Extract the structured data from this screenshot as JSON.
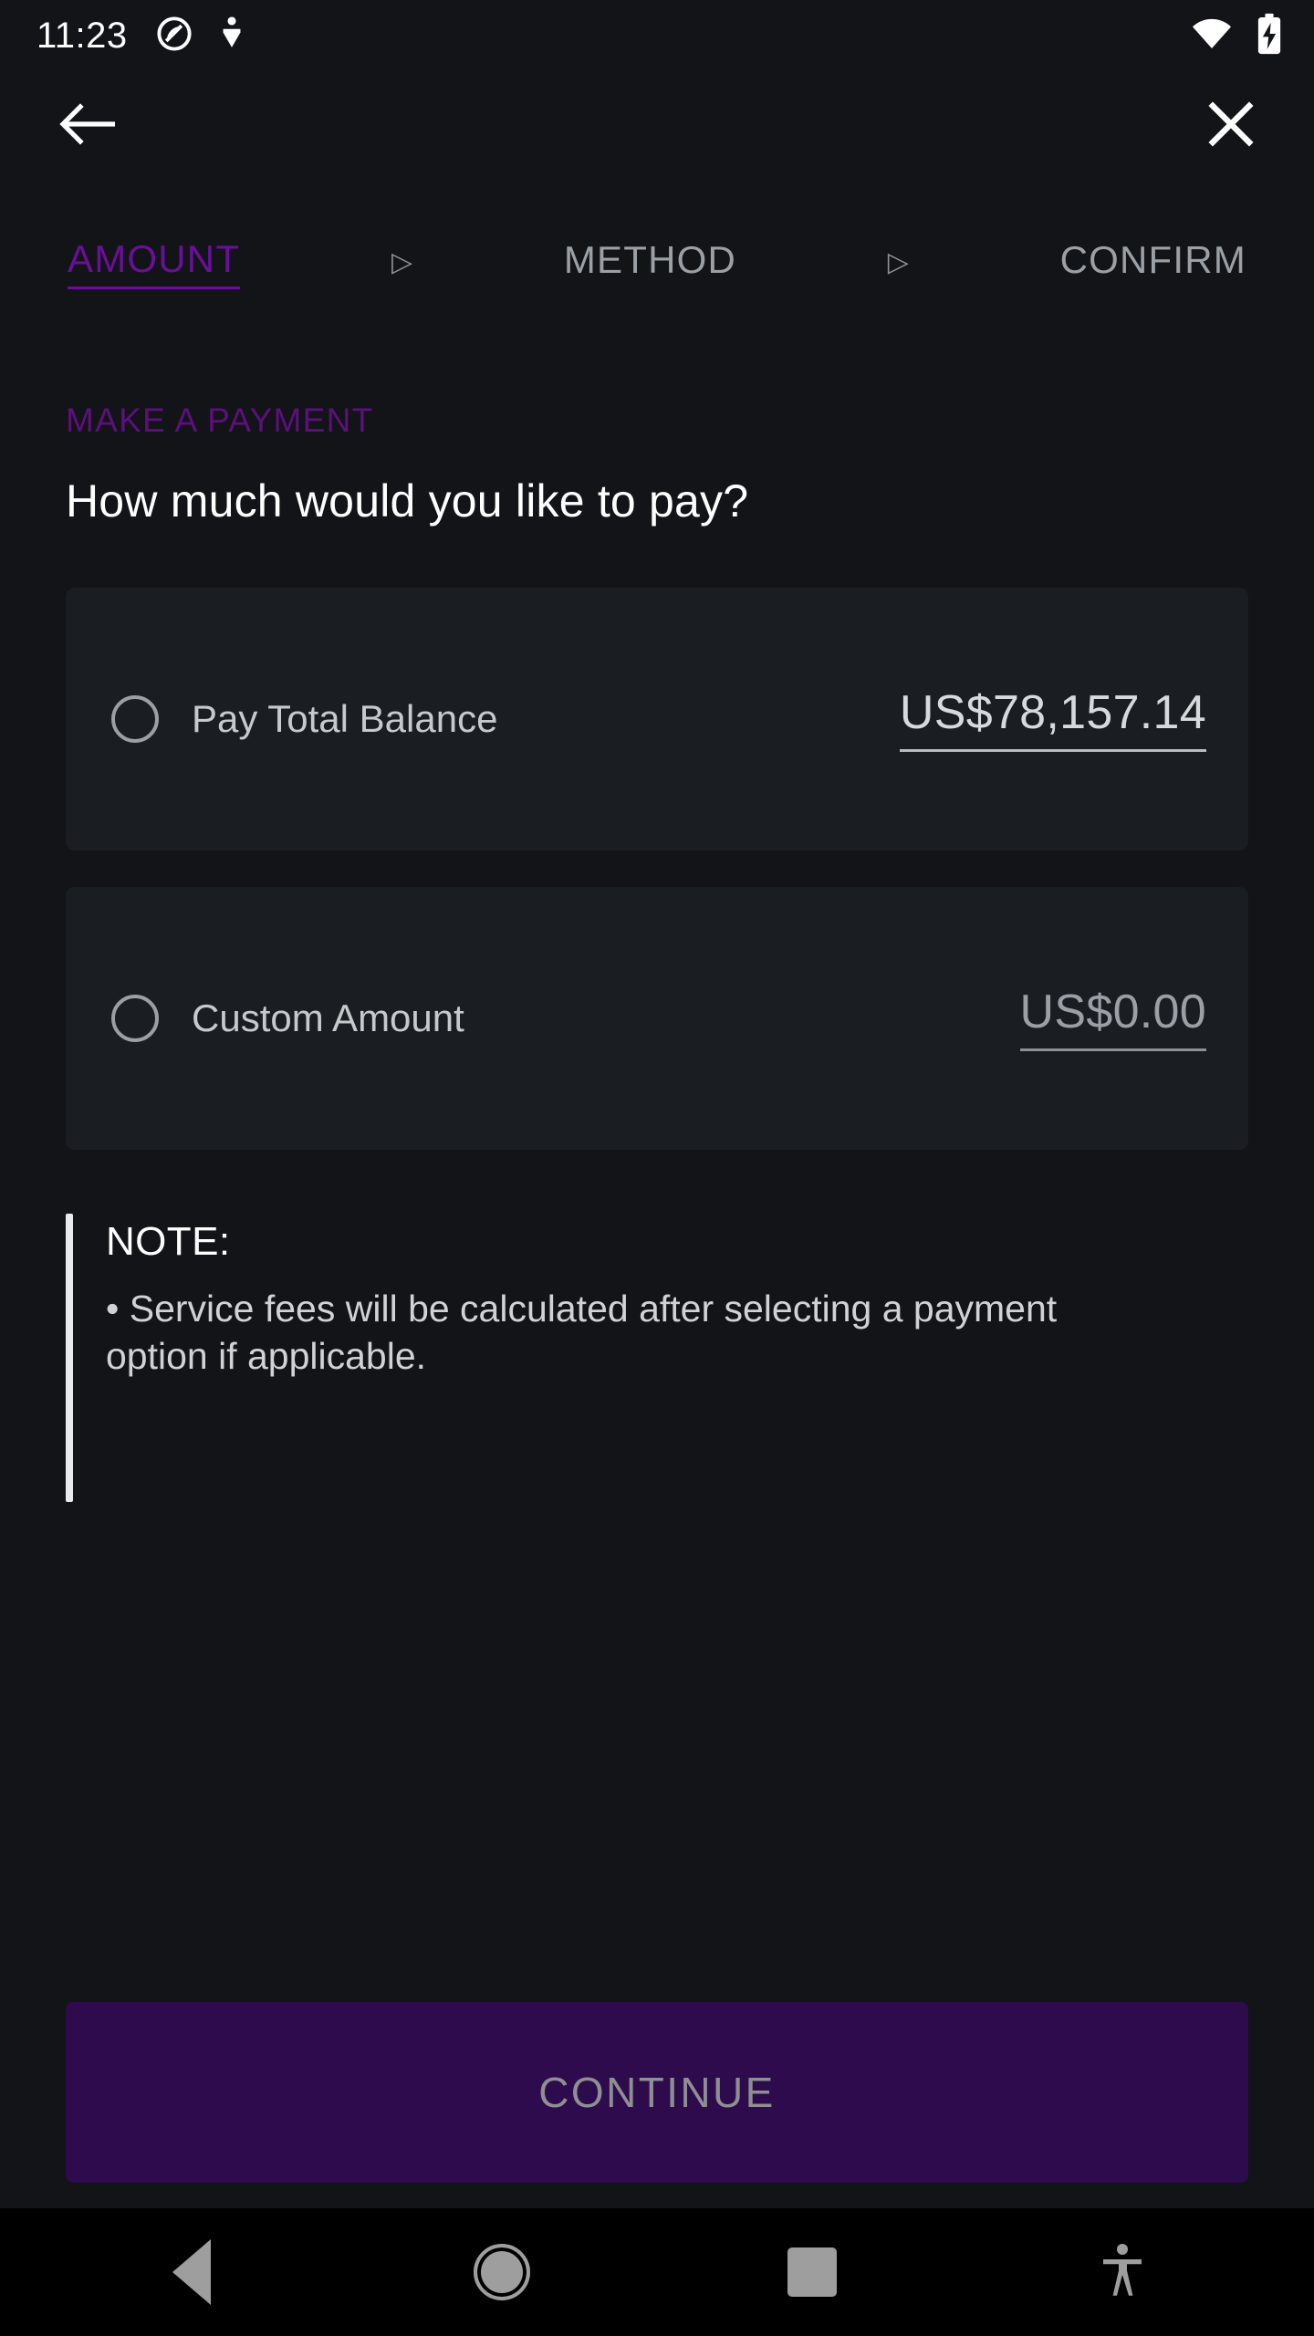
{
  "status_bar": {
    "time": "11:23",
    "left_icons": [
      "do-not-disturb-icon",
      "location-pin-icon"
    ],
    "right_icons": [
      "wifi-icon",
      "battery-charging-icon"
    ]
  },
  "app_bar": {
    "back_icon": "back-arrow-icon",
    "close_icon": "close-icon"
  },
  "stepper": {
    "separator": "▷",
    "steps": [
      {
        "label": "AMOUNT",
        "state": "active"
      },
      {
        "label": "METHOD",
        "state": "inactive"
      },
      {
        "label": "CONFIRM",
        "state": "inactive"
      }
    ]
  },
  "main": {
    "eyebrow": "MAKE A PAYMENT",
    "headline": "How much would you like to pay?",
    "options": [
      {
        "label": "Pay Total Balance",
        "value": "US$78,157.14",
        "selected": false
      },
      {
        "label": "Custom Amount",
        "value": "US$0.00",
        "selected": false
      }
    ],
    "note": {
      "title": "NOTE:",
      "text": "• Service fees will be calculated after selecting a payment option if applicable."
    },
    "cta_label": "CONTINUE"
  },
  "nav_bar": {
    "back_label": "back-triangle-icon",
    "home_label": "home-circle-icon",
    "recents_label": "recents-square-icon",
    "accessibility_label": "accessibility-icon"
  },
  "colors": {
    "page_background": "#121417",
    "card_background": "#1a1e23",
    "accent_purple": "#6a0f99",
    "eyebrow_purple": "#5c0f7d",
    "cta_background": "#2d0b4c",
    "cta_text": "#8e8e93",
    "muted_text": "#9aa0a6"
  }
}
